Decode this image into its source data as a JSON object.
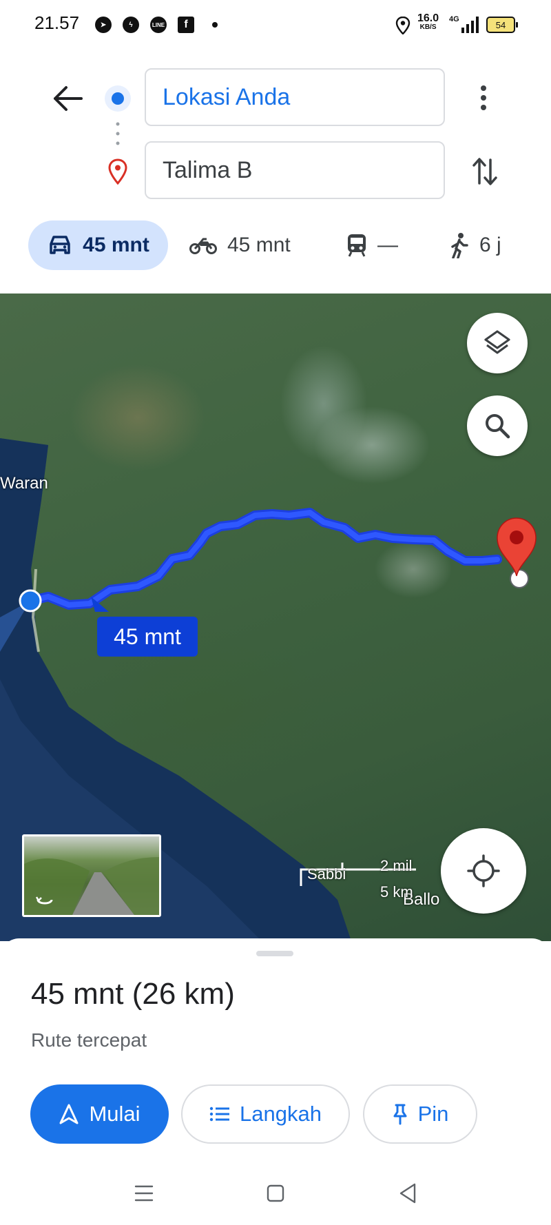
{
  "status_bar": {
    "time": "21.57",
    "app_icons": [
      "telegram-icon",
      "messenger-icon",
      "line-icon",
      "facebook-icon"
    ],
    "network_speed": "16.0",
    "network_unit": "KB/S",
    "network_type": "4G",
    "battery": "54"
  },
  "directions": {
    "origin": "Lokasi Anda",
    "destination": "Talima B"
  },
  "modes": [
    {
      "name": "drive",
      "icon": "car-icon",
      "label": "45 mnt",
      "selected": true
    },
    {
      "name": "motorcycle",
      "icon": "motorcycle-icon",
      "label": "45 mnt"
    },
    {
      "name": "transit",
      "icon": "train-icon",
      "label": "—"
    },
    {
      "name": "walk",
      "icon": "walking-icon",
      "label": "6 j"
    }
  ],
  "map": {
    "route_label": "45 mnt",
    "places": {
      "waran": "Waran",
      "sabbi": "Sabbi",
      "ballo": "Ballo"
    },
    "scale": {
      "imperial": "2 mil",
      "metric": "5 km"
    }
  },
  "sheet": {
    "summary": "45 mnt (26 km)",
    "route_description": "Rute tercepat",
    "buttons": {
      "start": "Mulai",
      "steps": "Langkah",
      "pin": "Pin"
    }
  },
  "colors": {
    "accent": "#1a73e8",
    "route": "#1f3bff",
    "selected_mode_bg": "#d3e3fd",
    "destination_pin": "#ea4335"
  }
}
